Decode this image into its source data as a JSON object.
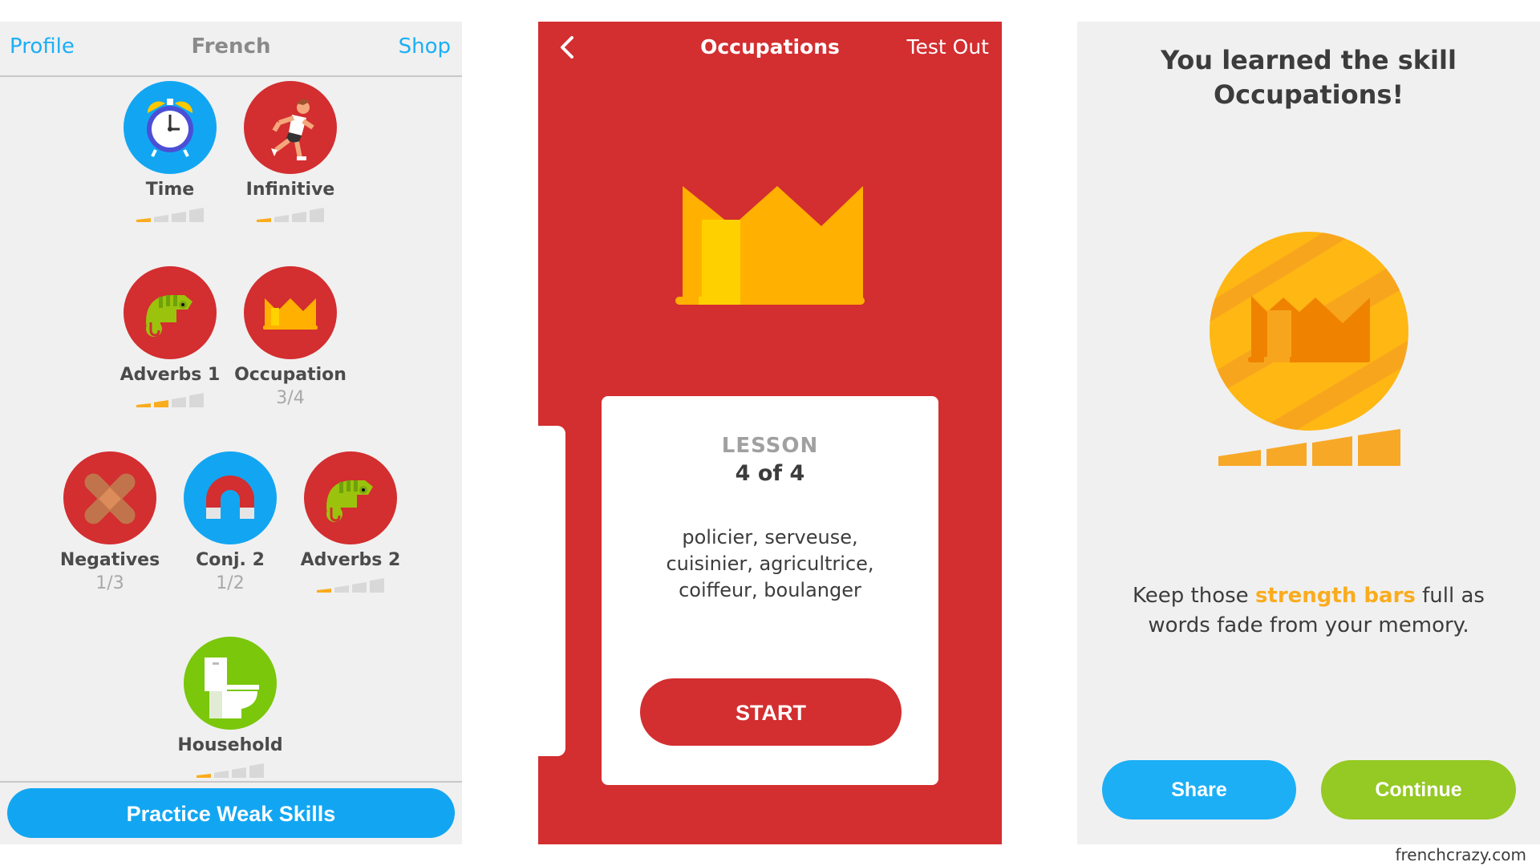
{
  "left_panel": {
    "header": {
      "profile_link": "Profile",
      "title": "French",
      "shop_link": "Shop"
    },
    "skills": [
      {
        "name": "Time",
        "icon": "alarm-clock-icon",
        "color": "#12a6f2",
        "strength": 0.25
      },
      {
        "name": "Infinitive",
        "icon": "runner-icon",
        "color": "#d32e30",
        "strength": 0.25
      },
      {
        "name": "Adverbs 1",
        "icon": "chameleon-icon",
        "color": "#d32e30",
        "strength": 0.5
      },
      {
        "name": "Occupation",
        "icon": "crown-icon",
        "color": "#d32e30",
        "progress": "3/4"
      },
      {
        "name": "Negatives",
        "icon": "bandage-x-icon",
        "color": "#d32e30",
        "progress": "1/3"
      },
      {
        "name": "Conj. 2",
        "icon": "magnet-icon",
        "color": "#12a6f2",
        "progress": "1/2"
      },
      {
        "name": "Adverbs 2",
        "icon": "chameleon-icon",
        "color": "#d32e30",
        "strength": 0.25
      },
      {
        "name": "Household",
        "icon": "toilet-icon",
        "color": "#7ac70c",
        "strength": 0.25
      }
    ],
    "practice_button": "Practice Weak Skills"
  },
  "middle_panel": {
    "header": {
      "back_icon": "chevron-left-icon",
      "title": "Occupations",
      "test_out": "Test Out"
    },
    "hero_icon": "crown-icon",
    "card": {
      "lesson_label": "LESSON",
      "lesson_count": "4 of 4",
      "words": [
        "policier, serveuse,",
        "cuisinier, agricultrice,",
        "coiffeur, boulanger"
      ],
      "start_button": "START"
    }
  },
  "right_panel": {
    "heading_line1": "You learned the skill",
    "heading_line2": "Occupations!",
    "badge_icon": "gold-crown-coin-icon",
    "strength": 1.0,
    "message_pre": "Keep those ",
    "message_highlight": "strength bars",
    "message_post": " full as",
    "message_line2": "words fade from your memory.",
    "share_button": "Share",
    "continue_button": "Continue"
  },
  "watermark": "frenchcrazy.com",
  "colors": {
    "red": "#d32e30",
    "blue": "#12a6f2",
    "green": "#95c923",
    "gold": "#faac1e",
    "panel_bg": "#f0f0f0"
  }
}
